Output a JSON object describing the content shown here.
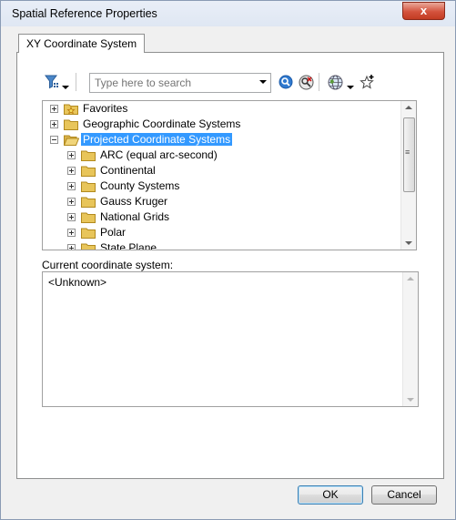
{
  "window": {
    "title": "Spatial Reference Properties",
    "close_glyph": "x"
  },
  "tabs": [
    {
      "label": "XY Coordinate System"
    }
  ],
  "toolbar": {
    "search_placeholder": "Type here to search",
    "icons": [
      "filter-icon",
      "filter-dropdown-icon",
      "search-icon",
      "clear-search-icon",
      "globe-icon",
      "globe-dropdown-icon",
      "add-favorite-icon"
    ]
  },
  "tree": {
    "items": [
      {
        "label": "Favorites",
        "level": 0,
        "expanded": false,
        "folder": "favorites",
        "selected": false
      },
      {
        "label": "Geographic Coordinate Systems",
        "level": 0,
        "expanded": false,
        "folder": "closed",
        "selected": false
      },
      {
        "label": "Projected Coordinate Systems",
        "level": 0,
        "expanded": true,
        "folder": "open",
        "selected": true
      },
      {
        "label": "ARC (equal arc-second)",
        "level": 1,
        "expanded": false,
        "folder": "closed",
        "selected": false
      },
      {
        "label": "Continental",
        "level": 1,
        "expanded": false,
        "folder": "closed",
        "selected": false
      },
      {
        "label": "County Systems",
        "level": 1,
        "expanded": false,
        "folder": "closed",
        "selected": false
      },
      {
        "label": "Gauss Kruger",
        "level": 1,
        "expanded": false,
        "folder": "closed",
        "selected": false
      },
      {
        "label": "National Grids",
        "level": 1,
        "expanded": false,
        "folder": "closed",
        "selected": false
      },
      {
        "label": "Polar",
        "level": 1,
        "expanded": false,
        "folder": "closed",
        "selected": false
      },
      {
        "label": "State Plane",
        "level": 1,
        "expanded": false,
        "folder": "closed",
        "selected": false
      }
    ]
  },
  "current": {
    "label": "Current coordinate system:",
    "value": "<Unknown>"
  },
  "buttons": {
    "ok": "OK",
    "cancel": "Cancel"
  },
  "colors": {
    "selection": "#3399ff",
    "folder": "#e8c55a",
    "default_button_border": "#3c7fb1"
  }
}
